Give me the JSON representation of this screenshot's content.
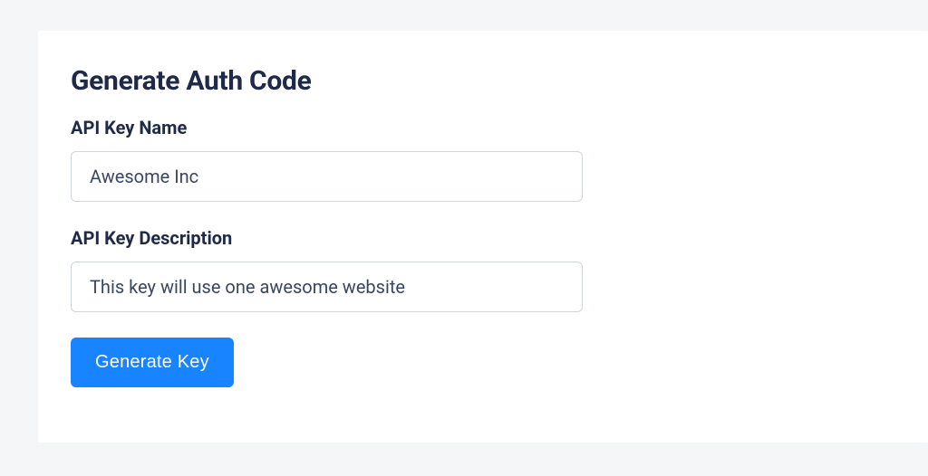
{
  "form": {
    "title": "Generate Auth Code",
    "fields": {
      "name": {
        "label": "API Key Name",
        "value": "Awesome Inc"
      },
      "description": {
        "label": "API Key Description",
        "value": "This key will use one awesome website"
      }
    },
    "submit_label": "Generate Key"
  }
}
